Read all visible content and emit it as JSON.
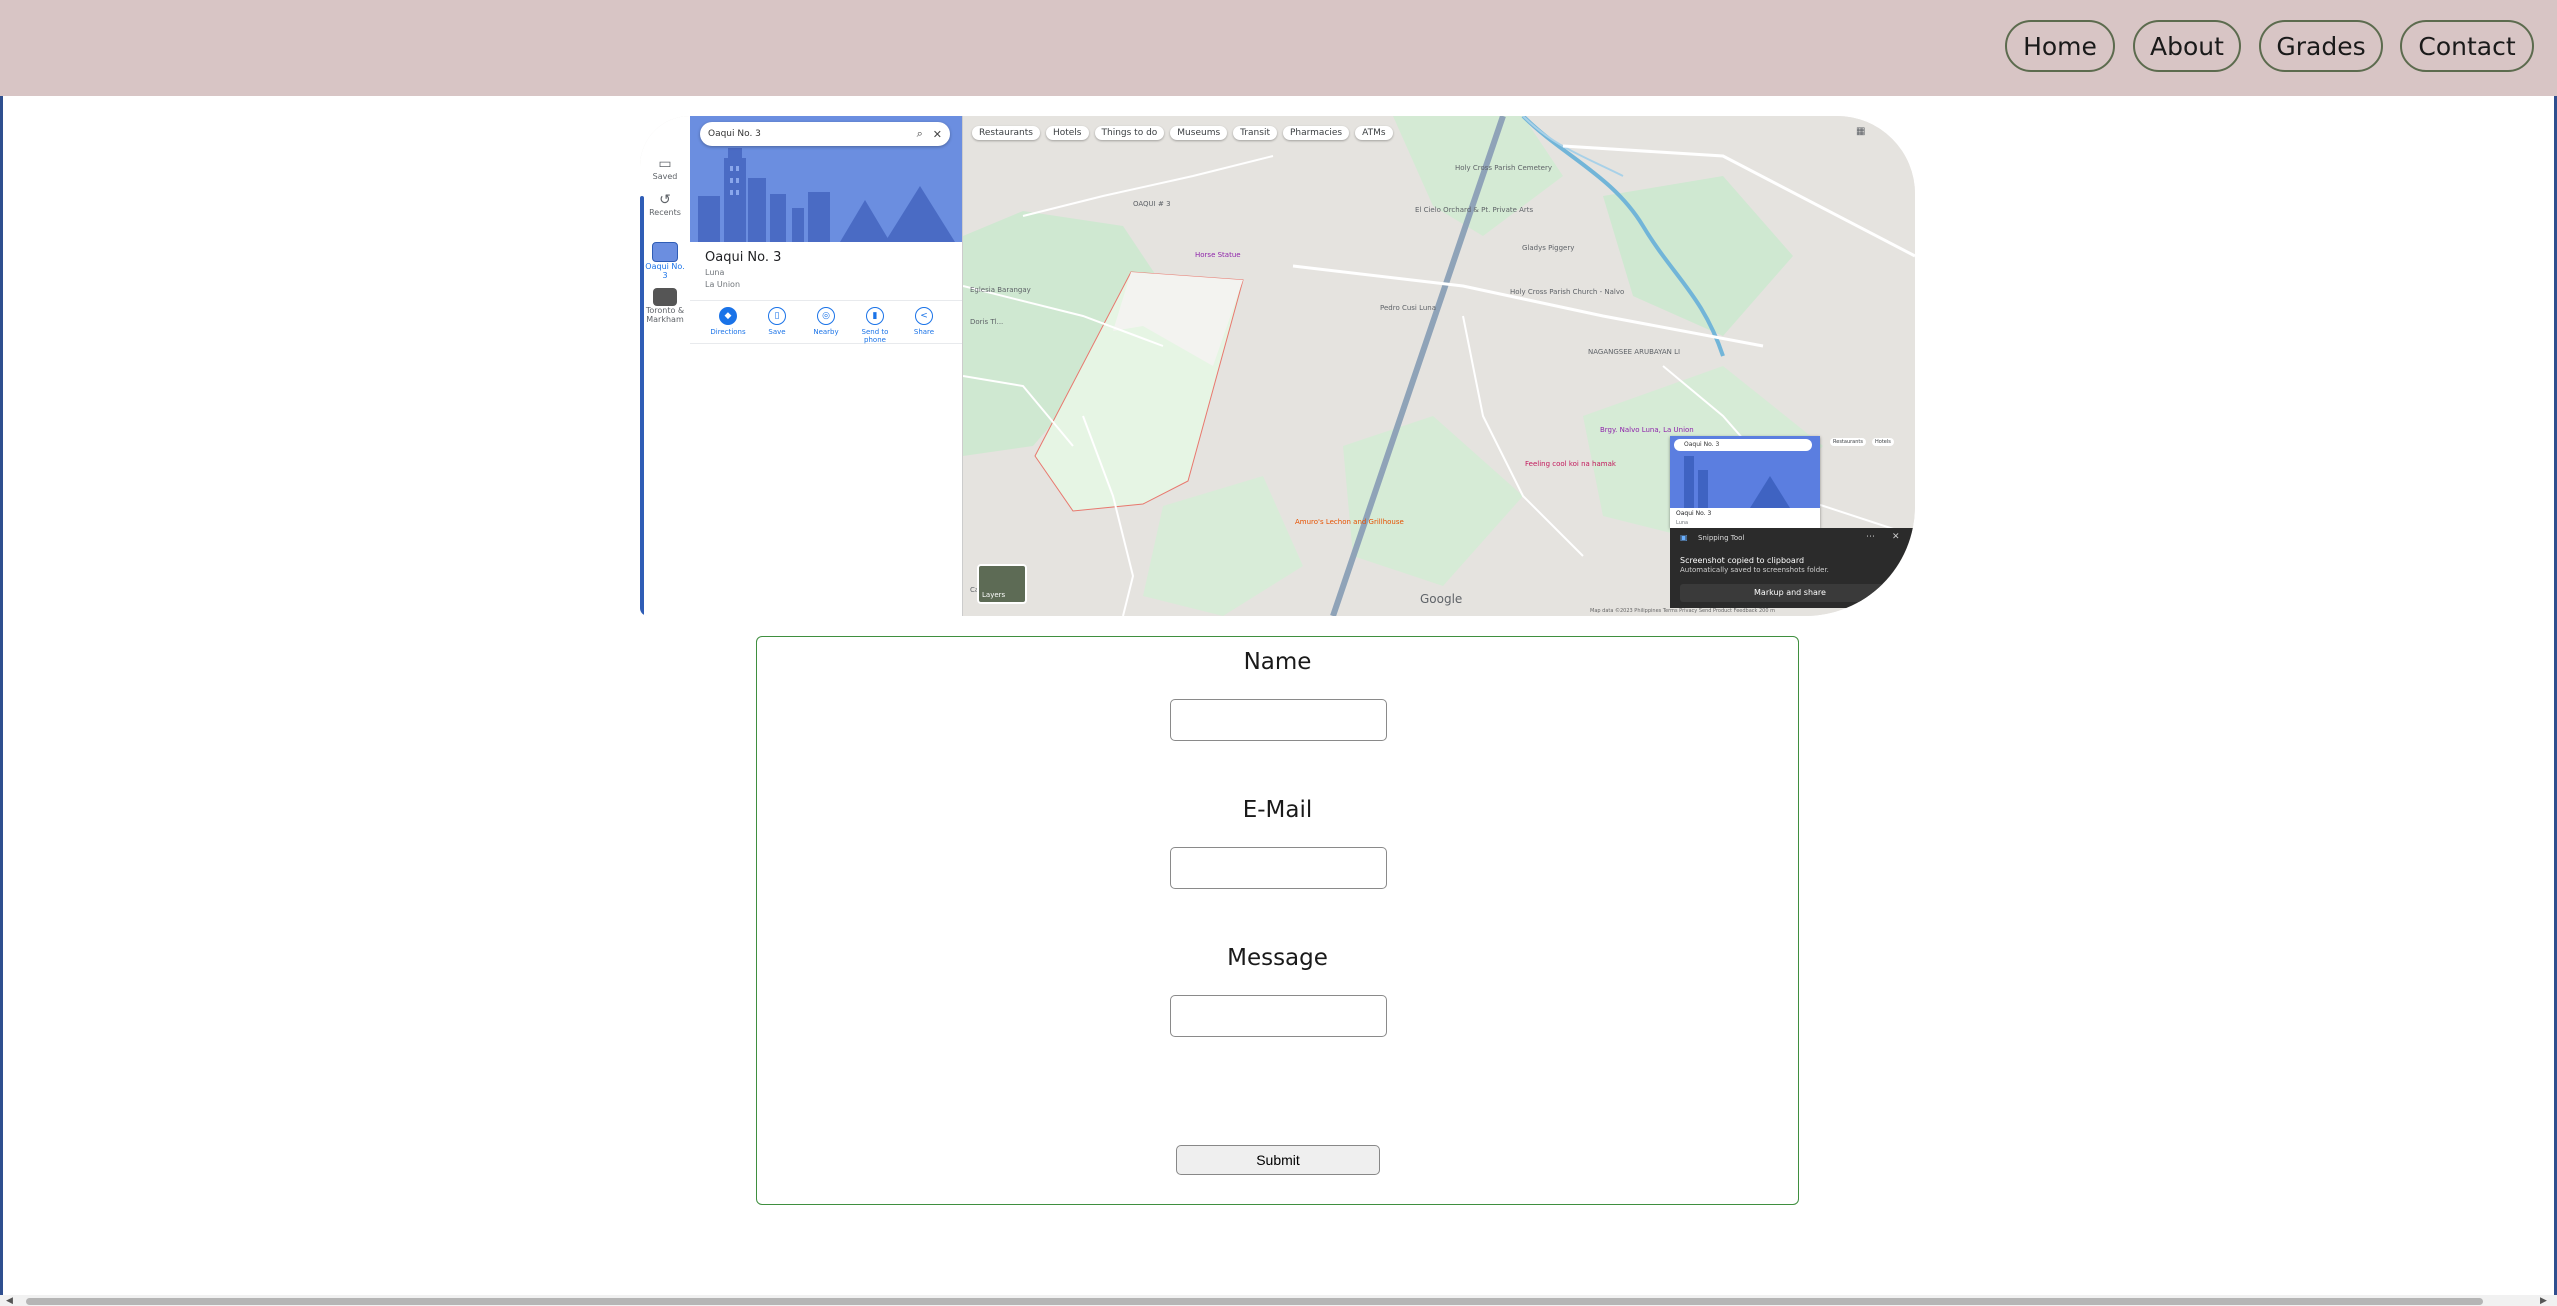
{
  "nav": {
    "items": [
      "Home",
      "About",
      "Grades",
      "Contact"
    ]
  },
  "map_screenshot": {
    "rail": {
      "saved": "Saved",
      "recents": "Recents",
      "place1": "Oaqui No. 3",
      "place2": "Toronto & Markham"
    },
    "search_query": "Oaqui No. 3",
    "place": {
      "title": "Oaqui No. 3",
      "line1": "Luna",
      "line2": "La Union"
    },
    "actions": [
      "Directions",
      "Save",
      "Nearby",
      "Send to phone",
      "Share"
    ],
    "chips": [
      "Restaurants",
      "Hotels",
      "Things to do",
      "Museums",
      "Transit",
      "Pharmacies",
      "ATMs"
    ],
    "pois": {
      "holy_cross": "Holy Cross Parish Cemetery",
      "el_cielo": "El Cielo Orchard & Pt. Private Arts",
      "oaqui": "OAQUI # 3",
      "gladys": "Gladys Piggery",
      "horse": "Horse Statue",
      "pedro": "Pedro Cusi Luna",
      "holy_church": "Holy Cross Parish Church - Nalvo",
      "nagangsee": "NAGANGSEE ARUBAYAN LI",
      "brgy": "Brgy. Nalvo Luna, La Union",
      "feeling": "Feeling cool koi na hamak",
      "amuro": "Amuro's Lechon and Grillhouse",
      "eglesia": "Eglesia Barangay",
      "doris": "Doris Tl...",
      "ca": "Ca"
    },
    "layers": "Layers",
    "google": "Google",
    "footer": "Map data ©2023   Philippines   Terms   Privacy   Send Product Feedback   200 m",
    "mini": {
      "search": "Oaqui No. 3",
      "title": "Oaqui No. 3",
      "sub": "Luna",
      "chip1": "Restaurants",
      "chip2": "Hotels"
    },
    "snip": {
      "title": "Snipping Tool",
      "msg1": "Screenshot copied to clipboard",
      "msg2": "Automatically saved to screenshots folder.",
      "button": "Markup and share"
    },
    "colors": {
      "map_bg": "#e5e3df",
      "park": "#cfe8d1",
      "river": "#72b5d8",
      "highway": "#8fa3b8",
      "boundary": "#e8786e",
      "brand_blue": "#1a73e8"
    }
  },
  "form": {
    "name_label": "Name",
    "email_label": "E-Mail",
    "message_label": "Message",
    "submit_label": "Submit",
    "name_value": "",
    "email_value": "",
    "message_value": ""
  },
  "colors": {
    "header_bg": "#d8c5c5",
    "nav_border": "#5c6b4e",
    "form_border": "#3f8f3f"
  }
}
